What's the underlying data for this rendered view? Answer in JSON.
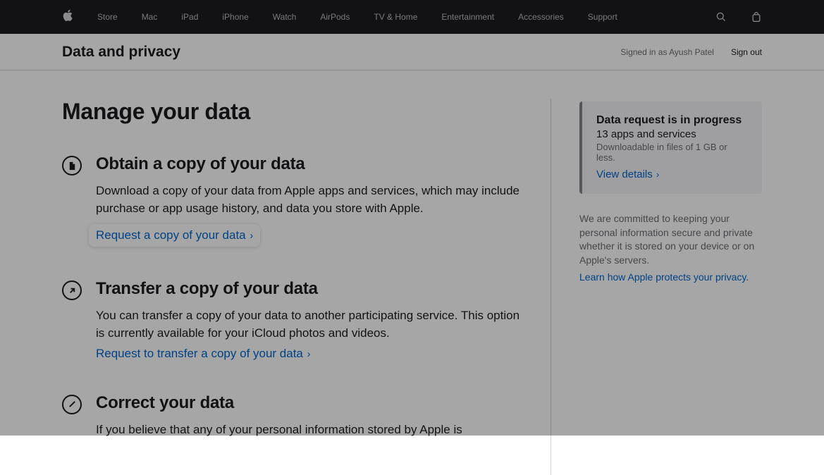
{
  "nav": {
    "items": [
      "Store",
      "Mac",
      "iPad",
      "iPhone",
      "Watch",
      "AirPods",
      "TV & Home",
      "Entertainment",
      "Accessories",
      "Support"
    ]
  },
  "subheader": {
    "title": "Data and privacy",
    "signed_in": "Signed in as Ayush Patel",
    "sign_out": "Sign out"
  },
  "page": {
    "title": "Manage your data"
  },
  "sections": {
    "obtain": {
      "heading": "Obtain a copy of your data",
      "body": "Download a copy of your data from Apple apps and services, which may include purchase or app usage history, and data you store with Apple.",
      "cta": "Request a copy of your data"
    },
    "transfer": {
      "heading": "Transfer a copy of your data",
      "body": "You can transfer a copy of your data to another participating service. This option is currently available for your iCloud photos and videos.",
      "cta": "Request to transfer a copy of your data"
    },
    "correct": {
      "heading": "Correct your data",
      "body": "If you believe that any of your personal information stored by Apple is"
    }
  },
  "notice": {
    "title": "Data request is in progress",
    "subtitle": "13 apps and services",
    "detail": "Downloadable in files of 1 GB or less.",
    "cta": "View details"
  },
  "commitment": {
    "text": "We are committed to keeping your personal information secure and private whether it is stored on your device or on Apple's servers.",
    "cta": "Learn how Apple protects your privacy."
  }
}
